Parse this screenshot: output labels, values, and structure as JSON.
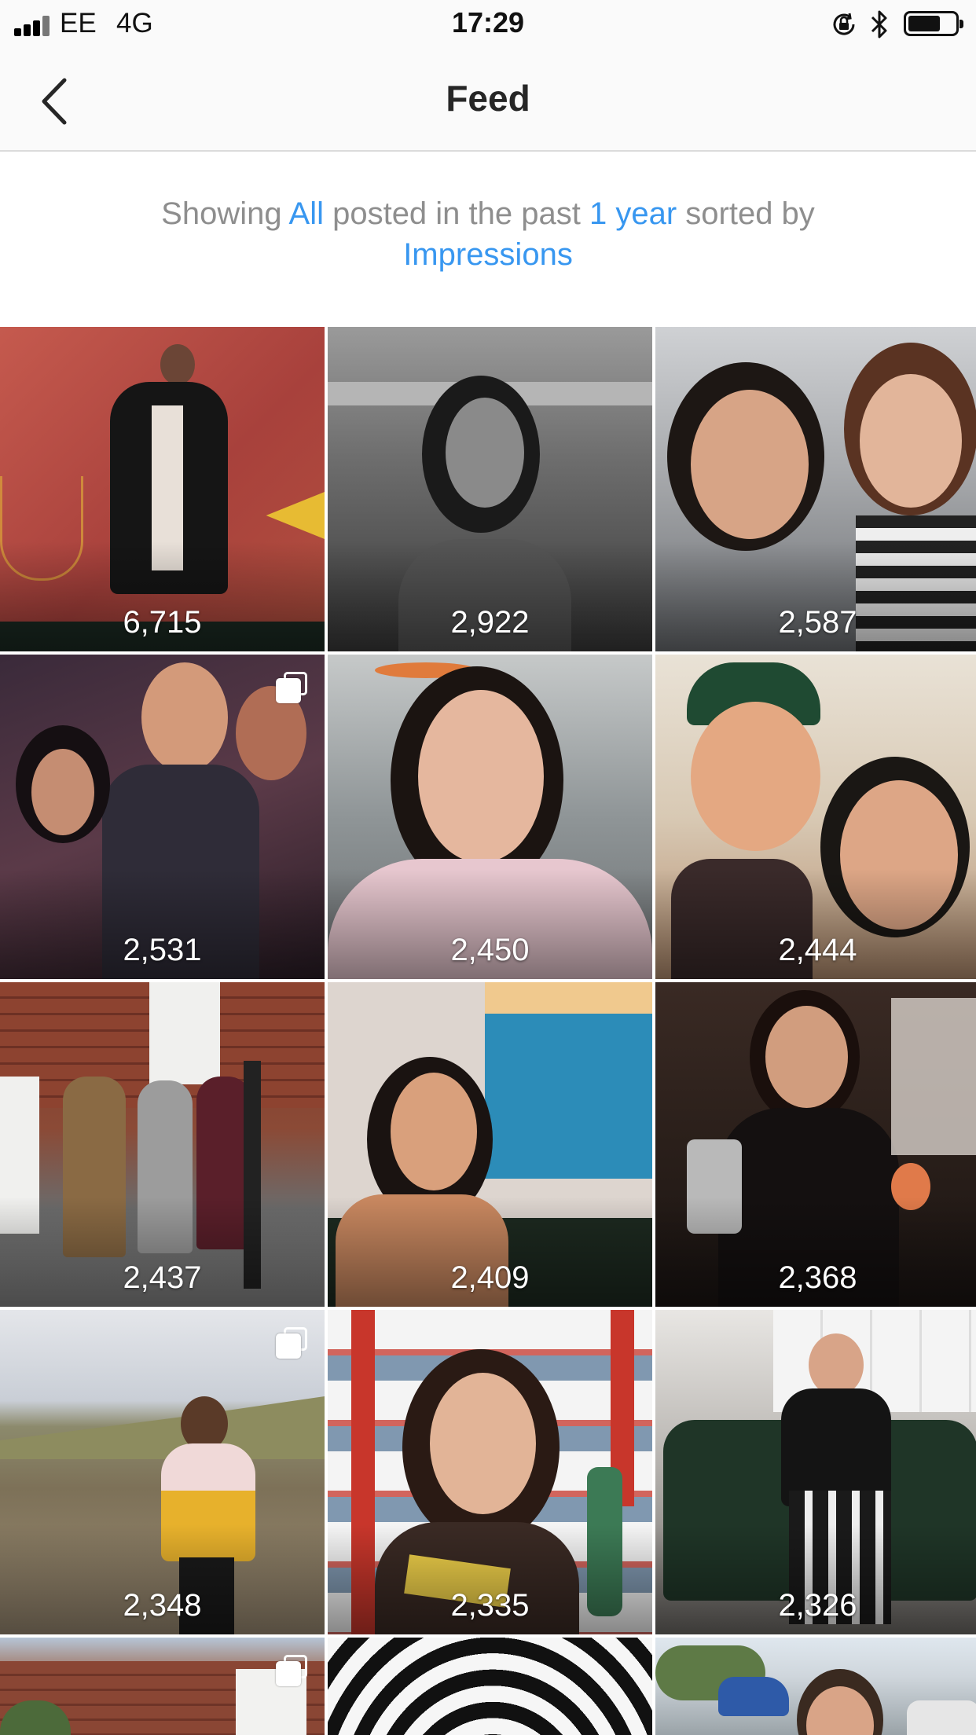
{
  "status_bar": {
    "carrier": "EE",
    "network": "4G",
    "time": "17:29",
    "icons": [
      "signal-icon",
      "orientation-lock-icon",
      "bluetooth-icon",
      "battery-icon"
    ]
  },
  "nav": {
    "title": "Feed",
    "back_icon": "chevron-left-icon"
  },
  "filter": {
    "prefix": "Showing ",
    "type": "All",
    "middle": " posted in the past ",
    "period": "1 year",
    "suffix": " sorted by ",
    "metric": "Impressions"
  },
  "colors": {
    "link": "#3897f0",
    "muted_text": "#8e8e8e",
    "title_text": "#262626"
  },
  "posts": [
    {
      "count": "6,715",
      "multi": false
    },
    {
      "count": "2,922",
      "multi": false
    },
    {
      "count": "2,587",
      "multi": false
    },
    {
      "count": "2,531",
      "multi": true
    },
    {
      "count": "2,450",
      "multi": false
    },
    {
      "count": "2,444",
      "multi": false
    },
    {
      "count": "2,437",
      "multi": false
    },
    {
      "count": "2,409",
      "multi": false
    },
    {
      "count": "2,368",
      "multi": false
    },
    {
      "count": "2,348",
      "multi": true
    },
    {
      "count": "2,335",
      "multi": false
    },
    {
      "count": "2,326",
      "multi": false
    },
    {
      "count": "",
      "multi": true
    },
    {
      "count": "",
      "multi": false
    },
    {
      "count": "",
      "multi": false
    }
  ]
}
